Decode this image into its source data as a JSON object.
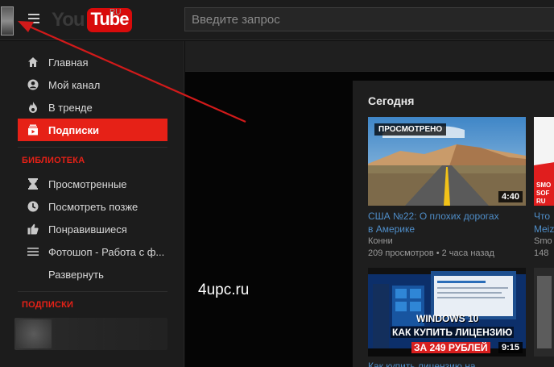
{
  "header": {
    "logo_you": "You",
    "logo_tube": "Tube",
    "logo_region": "RU",
    "search_placeholder": "Введите запрос"
  },
  "sidebar": {
    "items": [
      {
        "label": "Главная",
        "icon": "home-icon"
      },
      {
        "label": "Мой канал",
        "icon": "account-icon"
      },
      {
        "label": "В тренде",
        "icon": "flame-icon"
      },
      {
        "label": "Подписки",
        "icon": "subscriptions-icon",
        "active": true
      }
    ],
    "library_title": "БИБЛИОТЕКА",
    "library_items": [
      {
        "label": "Просмотренные",
        "icon": "history-icon"
      },
      {
        "label": "Посмотреть позже",
        "icon": "clock-icon"
      },
      {
        "label": "Понравившиеся",
        "icon": "thumbs-up-icon"
      },
      {
        "label": "Фотошоп - Работа с ф...",
        "icon": "playlist-icon"
      },
      {
        "label": "Развернуть",
        "icon": ""
      }
    ],
    "subscriptions_title": "ПОДПИСКИ"
  },
  "watermark": "4upc.ru",
  "feed": {
    "title": "Сегодня",
    "videos": [
      {
        "badge": "ПРОСМОТРЕНО",
        "duration": "4:40",
        "title_line1": "США №22: О плохих дорогах",
        "title_line2": "в Америке",
        "channel": "Конни",
        "meta": "209 просмотров • 2 часа назад"
      },
      {
        "duration": "9:15",
        "thumb_line1": "WINDOWS 10",
        "thumb_line2": "КАК КУПИТЬ ЛИЦЕНЗИЮ",
        "thumb_line3": "ЗА 249 РУБЛЕЙ",
        "title_line1": "Как купить лицензию на"
      }
    ],
    "peek": {
      "thumb_text1": "SMO",
      "thumb_text2": "SOF",
      "thumb_text3": "RU",
      "title_line1": "Что",
      "title_line2": "Meiz",
      "channel": "Smo",
      "meta": "148"
    }
  },
  "colors": {
    "accent": "#e62117",
    "link": "#4f8ec9",
    "arrow": "#d11a1a"
  }
}
